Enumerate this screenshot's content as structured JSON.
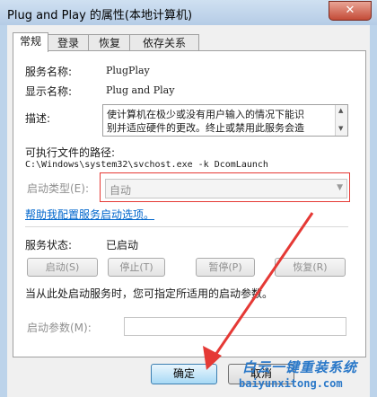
{
  "window": {
    "title": "Plug and Play 的属性(本地计算机)",
    "close_label": "✕"
  },
  "tabs": [
    {
      "label": "常规",
      "active": true
    },
    {
      "label": "登录",
      "active": false
    },
    {
      "label": "恢复",
      "active": false
    },
    {
      "label": "依存关系",
      "active": false
    }
  ],
  "general": {
    "service_name_label": "服务名称:",
    "service_name": "PlugPlay",
    "display_name_label": "显示名称:",
    "display_name": "Plug and Play",
    "description_label": "描述:",
    "description_line1": "使计算机在极少或没有用户输入的情况下能识",
    "description_line2": "别并适应硬件的更改。终止或禁用此服务会造",
    "exe_path_label": "可执行文件的路径:",
    "exe_path": "C:\\Windows\\system32\\svchost.exe -k DcomLaunch",
    "startup_type_label": "启动类型(E):",
    "startup_type_value": "自动",
    "help_link": "帮助我配置服务启动选项。",
    "status_label": "服务状态:",
    "status_value": "已启动",
    "buttons": {
      "start": "启动(S)",
      "stop": "停止(T)",
      "pause": "暂停(P)",
      "resume": "恢复(R)"
    },
    "start_params_hint": "当从此处启动服务时，您可指定所适用的启动参数。",
    "start_params_label": "启动参数(M):",
    "start_params_value": ""
  },
  "footer": {
    "ok": "确定",
    "cancel": "取消"
  },
  "watermark": {
    "text": "白云一键重装系统",
    "url": "baiyunxitong.com"
  },
  "colors": {
    "link": "#0066cc",
    "annotation": "#e53935",
    "watermark": "#2a78c8"
  }
}
